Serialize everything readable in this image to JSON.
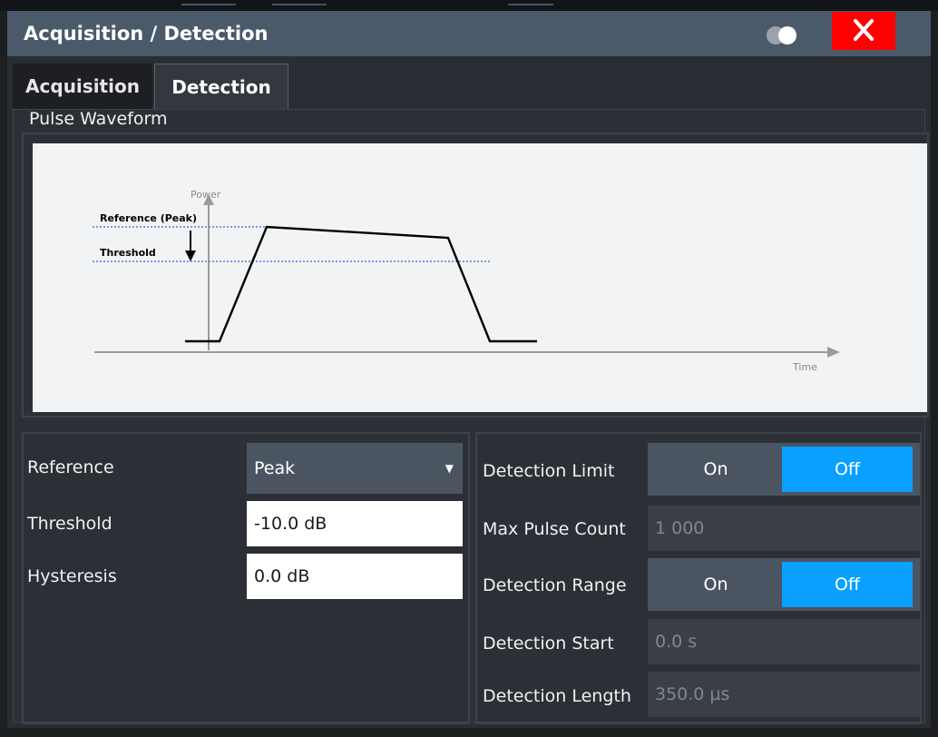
{
  "window": {
    "title": "Acquisition / Detection",
    "close_label": "✕"
  },
  "tabs": [
    {
      "label": "Acquisition",
      "active": false
    },
    {
      "label": "Detection",
      "active": true
    }
  ],
  "pulse_waveform": {
    "title": "Pulse Waveform",
    "power_label": "Power",
    "time_label": "Time",
    "reference_label": "Reference (Peak)",
    "threshold_label": "Threshold"
  },
  "left_settings": {
    "reference": {
      "label": "Reference",
      "value": "Peak"
    },
    "threshold": {
      "label": "Threshold",
      "value": "-10.0 dB"
    },
    "hysteresis": {
      "label": "Hysteresis",
      "value": "0.0 dB"
    }
  },
  "right_settings": {
    "detection_limit": {
      "label": "Detection Limit",
      "on": "On",
      "off": "Off",
      "selected": "Off"
    },
    "max_pulse_count": {
      "label": "Max Pulse Count",
      "value": "1 000"
    },
    "detection_range": {
      "label": "Detection Range",
      "on": "On",
      "off": "Off",
      "selected": "Off"
    },
    "detection_start": {
      "label": "Detection Start",
      "value": "0.0 s"
    },
    "detection_length": {
      "label": "Detection Length",
      "value": "350.0 µs"
    }
  },
  "colors": {
    "title_bar": "#4b5a6b",
    "close_button": "#ff0000",
    "toggle_selected": "#0aa0ff",
    "dashed_line": "#3c5cd8"
  },
  "icons": {
    "theme_toggle": "theme-toggle-icon",
    "close": "close-icon",
    "dropdown": "chevron-down-icon"
  }
}
